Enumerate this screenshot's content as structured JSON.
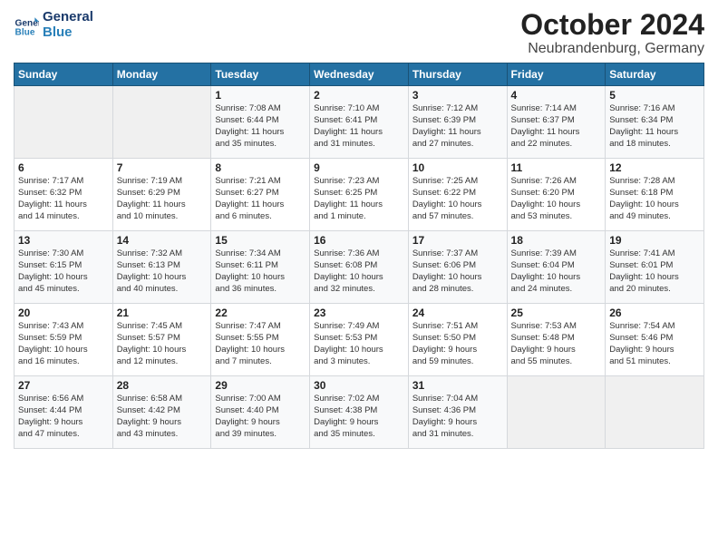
{
  "header": {
    "logo_line1": "General",
    "logo_line2": "Blue",
    "month": "October 2024",
    "location": "Neubrandenburg, Germany"
  },
  "weekdays": [
    "Sunday",
    "Monday",
    "Tuesday",
    "Wednesday",
    "Thursday",
    "Friday",
    "Saturday"
  ],
  "weeks": [
    [
      {
        "day": "",
        "info": ""
      },
      {
        "day": "",
        "info": ""
      },
      {
        "day": "1",
        "info": "Sunrise: 7:08 AM\nSunset: 6:44 PM\nDaylight: 11 hours\nand 35 minutes."
      },
      {
        "day": "2",
        "info": "Sunrise: 7:10 AM\nSunset: 6:41 PM\nDaylight: 11 hours\nand 31 minutes."
      },
      {
        "day": "3",
        "info": "Sunrise: 7:12 AM\nSunset: 6:39 PM\nDaylight: 11 hours\nand 27 minutes."
      },
      {
        "day": "4",
        "info": "Sunrise: 7:14 AM\nSunset: 6:37 PM\nDaylight: 11 hours\nand 22 minutes."
      },
      {
        "day": "5",
        "info": "Sunrise: 7:16 AM\nSunset: 6:34 PM\nDaylight: 11 hours\nand 18 minutes."
      }
    ],
    [
      {
        "day": "6",
        "info": "Sunrise: 7:17 AM\nSunset: 6:32 PM\nDaylight: 11 hours\nand 14 minutes."
      },
      {
        "day": "7",
        "info": "Sunrise: 7:19 AM\nSunset: 6:29 PM\nDaylight: 11 hours\nand 10 minutes."
      },
      {
        "day": "8",
        "info": "Sunrise: 7:21 AM\nSunset: 6:27 PM\nDaylight: 11 hours\nand 6 minutes."
      },
      {
        "day": "9",
        "info": "Sunrise: 7:23 AM\nSunset: 6:25 PM\nDaylight: 11 hours\nand 1 minute."
      },
      {
        "day": "10",
        "info": "Sunrise: 7:25 AM\nSunset: 6:22 PM\nDaylight: 10 hours\nand 57 minutes."
      },
      {
        "day": "11",
        "info": "Sunrise: 7:26 AM\nSunset: 6:20 PM\nDaylight: 10 hours\nand 53 minutes."
      },
      {
        "day": "12",
        "info": "Sunrise: 7:28 AM\nSunset: 6:18 PM\nDaylight: 10 hours\nand 49 minutes."
      }
    ],
    [
      {
        "day": "13",
        "info": "Sunrise: 7:30 AM\nSunset: 6:15 PM\nDaylight: 10 hours\nand 45 minutes."
      },
      {
        "day": "14",
        "info": "Sunrise: 7:32 AM\nSunset: 6:13 PM\nDaylight: 10 hours\nand 40 minutes."
      },
      {
        "day": "15",
        "info": "Sunrise: 7:34 AM\nSunset: 6:11 PM\nDaylight: 10 hours\nand 36 minutes."
      },
      {
        "day": "16",
        "info": "Sunrise: 7:36 AM\nSunset: 6:08 PM\nDaylight: 10 hours\nand 32 minutes."
      },
      {
        "day": "17",
        "info": "Sunrise: 7:37 AM\nSunset: 6:06 PM\nDaylight: 10 hours\nand 28 minutes."
      },
      {
        "day": "18",
        "info": "Sunrise: 7:39 AM\nSunset: 6:04 PM\nDaylight: 10 hours\nand 24 minutes."
      },
      {
        "day": "19",
        "info": "Sunrise: 7:41 AM\nSunset: 6:01 PM\nDaylight: 10 hours\nand 20 minutes."
      }
    ],
    [
      {
        "day": "20",
        "info": "Sunrise: 7:43 AM\nSunset: 5:59 PM\nDaylight: 10 hours\nand 16 minutes."
      },
      {
        "day": "21",
        "info": "Sunrise: 7:45 AM\nSunset: 5:57 PM\nDaylight: 10 hours\nand 12 minutes."
      },
      {
        "day": "22",
        "info": "Sunrise: 7:47 AM\nSunset: 5:55 PM\nDaylight: 10 hours\nand 7 minutes."
      },
      {
        "day": "23",
        "info": "Sunrise: 7:49 AM\nSunset: 5:53 PM\nDaylight: 10 hours\nand 3 minutes."
      },
      {
        "day": "24",
        "info": "Sunrise: 7:51 AM\nSunset: 5:50 PM\nDaylight: 9 hours\nand 59 minutes."
      },
      {
        "day": "25",
        "info": "Sunrise: 7:53 AM\nSunset: 5:48 PM\nDaylight: 9 hours\nand 55 minutes."
      },
      {
        "day": "26",
        "info": "Sunrise: 7:54 AM\nSunset: 5:46 PM\nDaylight: 9 hours\nand 51 minutes."
      }
    ],
    [
      {
        "day": "27",
        "info": "Sunrise: 6:56 AM\nSunset: 4:44 PM\nDaylight: 9 hours\nand 47 minutes."
      },
      {
        "day": "28",
        "info": "Sunrise: 6:58 AM\nSunset: 4:42 PM\nDaylight: 9 hours\nand 43 minutes."
      },
      {
        "day": "29",
        "info": "Sunrise: 7:00 AM\nSunset: 4:40 PM\nDaylight: 9 hours\nand 39 minutes."
      },
      {
        "day": "30",
        "info": "Sunrise: 7:02 AM\nSunset: 4:38 PM\nDaylight: 9 hours\nand 35 minutes."
      },
      {
        "day": "31",
        "info": "Sunrise: 7:04 AM\nSunset: 4:36 PM\nDaylight: 9 hours\nand 31 minutes."
      },
      {
        "day": "",
        "info": ""
      },
      {
        "day": "",
        "info": ""
      }
    ]
  ]
}
